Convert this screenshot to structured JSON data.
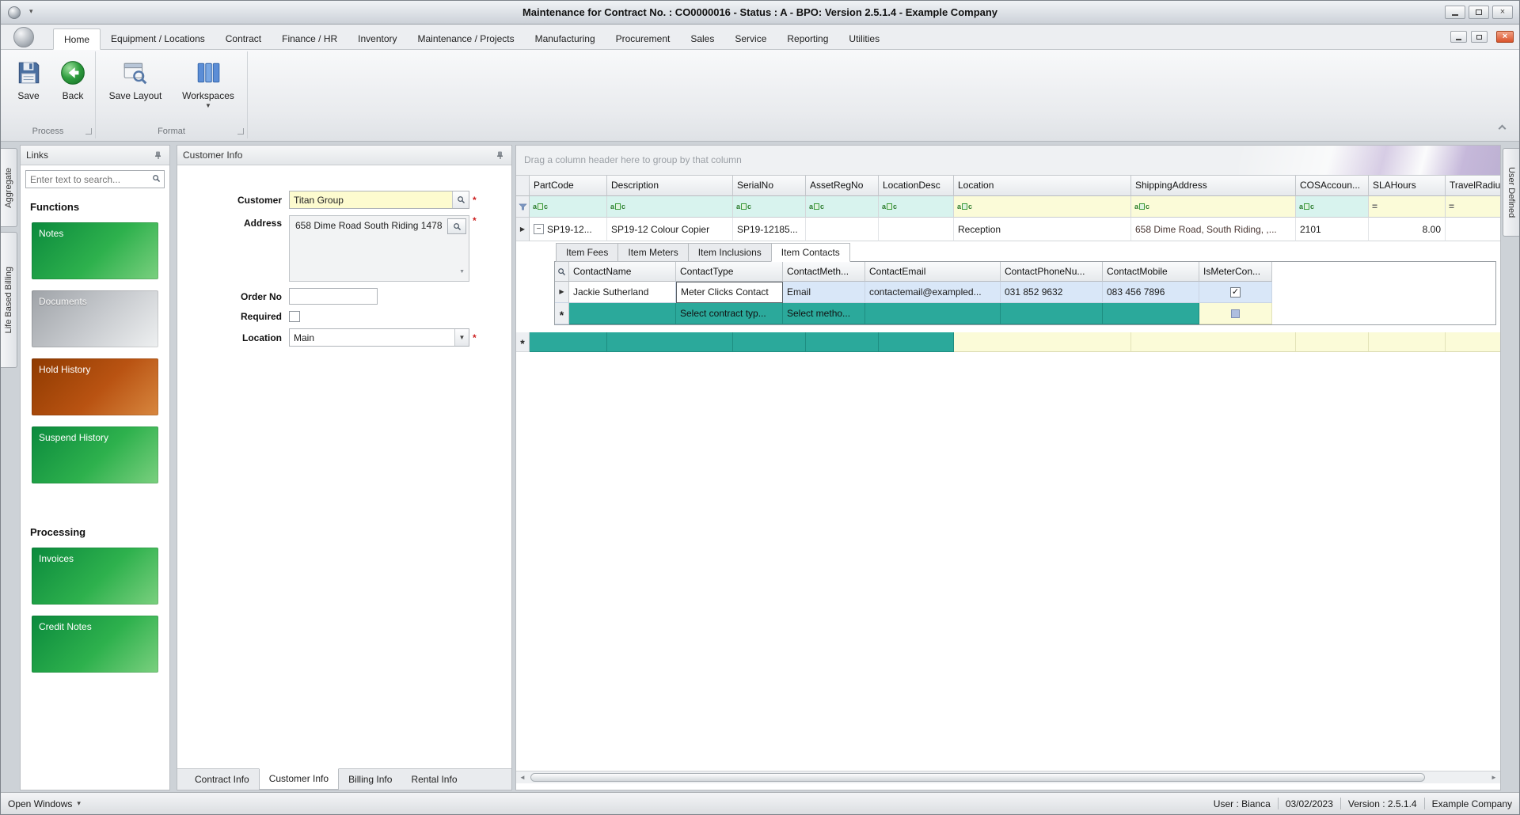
{
  "titlebar": {
    "title": "Maintenance for Contract No. : CO0000016 - Status : A - BPO: Version 2.5.1.4 - Example Company"
  },
  "ribbon": {
    "tabs": [
      "Home",
      "Equipment / Locations",
      "Contract",
      "Finance / HR",
      "Inventory",
      "Maintenance / Projects",
      "Manufacturing",
      "Procurement",
      "Sales",
      "Service",
      "Reporting",
      "Utilities"
    ],
    "buttons": {
      "save": "Save",
      "back": "Back",
      "save_layout": "Save Layout",
      "workspaces": "Workspaces"
    },
    "groups": {
      "process": "Process",
      "format": "Format"
    }
  },
  "side_tabs": {
    "aggregate": "Aggregate",
    "life_based_billing": "Life Based Billing",
    "user_defined": "User Defined"
  },
  "links": {
    "title": "Links",
    "search_placeholder": "Enter text to search...",
    "functions_heading": "Functions",
    "processing_heading": "Processing",
    "function_buttons": [
      {
        "label": "Notes"
      },
      {
        "label": "Documents"
      },
      {
        "label": "Hold History"
      },
      {
        "label": "Suspend History"
      }
    ],
    "processing_buttons": [
      {
        "label": "Invoices"
      },
      {
        "label": "Credit Notes"
      }
    ]
  },
  "customer": {
    "title": "Customer Info",
    "labels": {
      "customer": "Customer",
      "address": "Address",
      "order_no": "Order No",
      "required": "Required",
      "location": "Location"
    },
    "values": {
      "customer": "Titan Group",
      "order_no": "",
      "location": "Main"
    },
    "address_lines": [
      "658 Dime Road",
      "South Riding",
      "",
      "1478"
    ],
    "tabs": [
      "Contract Info",
      "Customer Info",
      "Billing Info",
      "Rental Info"
    ]
  },
  "grid": {
    "group_hint": "Drag a column header here to group by that column",
    "columns": [
      "PartCode",
      "Description",
      "SerialNo",
      "AssetRegNo",
      "LocationDesc",
      "Location",
      "ShippingAddress",
      "COSAccoun...",
      "SLAHours",
      "TravelRadiu..."
    ],
    "row": {
      "part_code": "SP19-12...",
      "description": "SP19-12 Colour Copier",
      "serial_no": "SP19-12185...",
      "asset_reg_no": "",
      "location_desc": "",
      "location": "Reception",
      "shipping_address": "658 Dime Road, South Riding, ,...",
      "cos_account": "2101",
      "sla_hours": "8.00",
      "travel_radius": ""
    },
    "detail": {
      "tabs": [
        "Item Fees",
        "Item Meters",
        "Item Inclusions",
        "Item Contacts"
      ],
      "columns": [
        "ContactName",
        "ContactType",
        "ContactMeth...",
        "ContactEmail",
        "ContactPhoneNu...",
        "ContactMobile",
        "IsMeterCon..."
      ],
      "row": {
        "contact_name": "Jackie Sutherland",
        "contact_type": "Meter Clicks Contact",
        "contact_method": "Email",
        "contact_email": "contactemail@exampled...",
        "contact_phone": "031 852 9632",
        "contact_mobile": "083 456 7896"
      },
      "new_row": {
        "contact_type": "Select contract typ...",
        "contact_method": "Select metho..."
      }
    }
  },
  "statusbar": {
    "open_windows": "Open Windows",
    "user": "User : Bianca",
    "date": "03/02/2023",
    "version": "Version : 2.5.1.4",
    "company": "Example Company"
  },
  "icons": {
    "dropdown": "▼",
    "caret_small": "▾",
    "row_arrow": "▶",
    "new_row_marker": "*",
    "equals_filter": "=",
    "check": "✓",
    "close": "×",
    "scroll_left": "◄",
    "scroll_right": "►",
    "expand_minus": "−",
    "abc_a": "a",
    "abc_c": "c"
  },
  "colors": {
    "teal_new_row": "#2BA99B",
    "green_button": "#1E9A46",
    "orange_button": "#B4500F",
    "silver_button": "#C2C6CB",
    "filter_cyan": "#D8F3EE",
    "filter_yellow": "#FBFBD8",
    "selected_row": "#D9E7F8"
  }
}
